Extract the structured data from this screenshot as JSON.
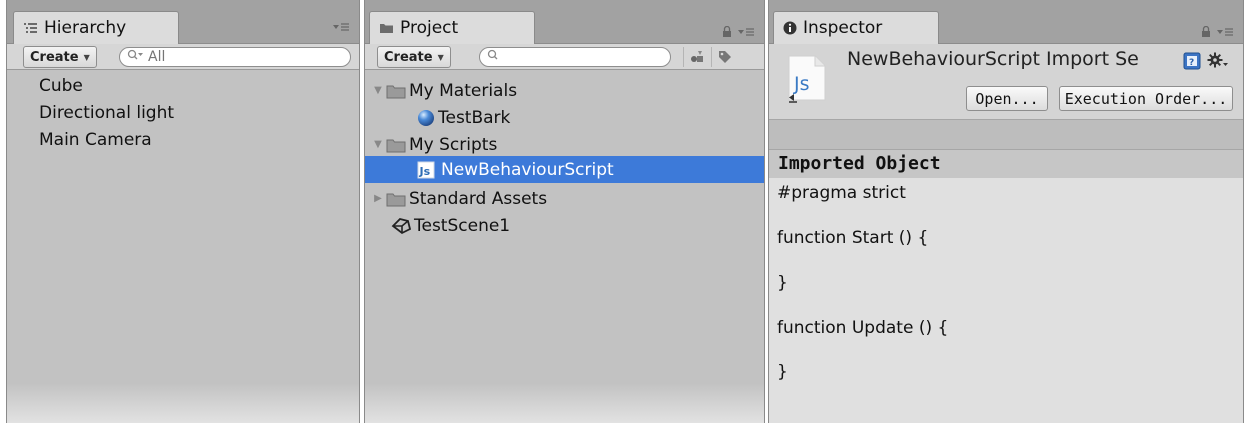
{
  "hierarchy": {
    "tab_label": "Hierarchy",
    "create_label": "Create",
    "search_placeholder": "All",
    "items": [
      {
        "label": "Cube"
      },
      {
        "label": "Directional light"
      },
      {
        "label": "Main Camera"
      }
    ]
  },
  "project": {
    "tab_label": "Project",
    "create_label": "Create",
    "search_placeholder": "",
    "tree": [
      {
        "label": "My Materials",
        "type": "folder",
        "expanded": true
      },
      {
        "label": "TestBark",
        "type": "material"
      },
      {
        "label": "My Scripts",
        "type": "folder",
        "expanded": true
      },
      {
        "label": "NewBehaviourScript",
        "type": "script",
        "selected": true
      },
      {
        "label": "Standard Assets",
        "type": "folder",
        "expanded": false
      },
      {
        "label": "TestScene1",
        "type": "scene"
      }
    ]
  },
  "inspector": {
    "tab_label": "Inspector",
    "asset_title": "NewBehaviourScript Import Se",
    "open_button": "Open...",
    "execution_order_button": "Execution Order...",
    "section_title": "Imported Object",
    "code_lines": [
      "#pragma strict",
      "function Start () {",
      "}",
      "function Update () {",
      "}"
    ]
  },
  "colors": {
    "selection": "#3d7ad9",
    "panel_bg": "#c2c2c2",
    "tab_bg": "#dcdcdc"
  }
}
